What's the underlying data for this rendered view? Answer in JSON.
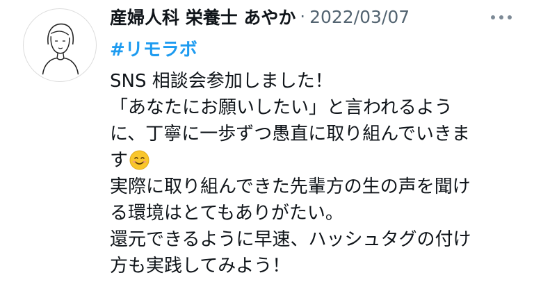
{
  "author": {
    "display_name": "産婦人科 栄養士 あやか",
    "separator": "·",
    "date": "2022/03/07"
  },
  "tweet": {
    "hashtag": "#リモラボ",
    "lines": [
      "SNS 相談会参加しました！",
      "「あなたにお願いしたい」と言われるよう",
      "に、丁寧に一歩ずつ愚直に取り組んでいきま",
      "す",
      "実際に取り組んできた先輩方の生の声を聞け",
      "る環境はとてもありがたい。",
      "還元できるように早速、ハッシュタグの付け",
      "方も実践してみよう！"
    ]
  },
  "icons": {
    "avatar": "line-drawing-person-avatar",
    "more": "more-options-icon",
    "emoji": "smiling-face-emoji"
  },
  "colors": {
    "text": "#0f1419",
    "secondary": "#536471",
    "link": "#1d9bf0",
    "emoji": "#f9c62b"
  }
}
